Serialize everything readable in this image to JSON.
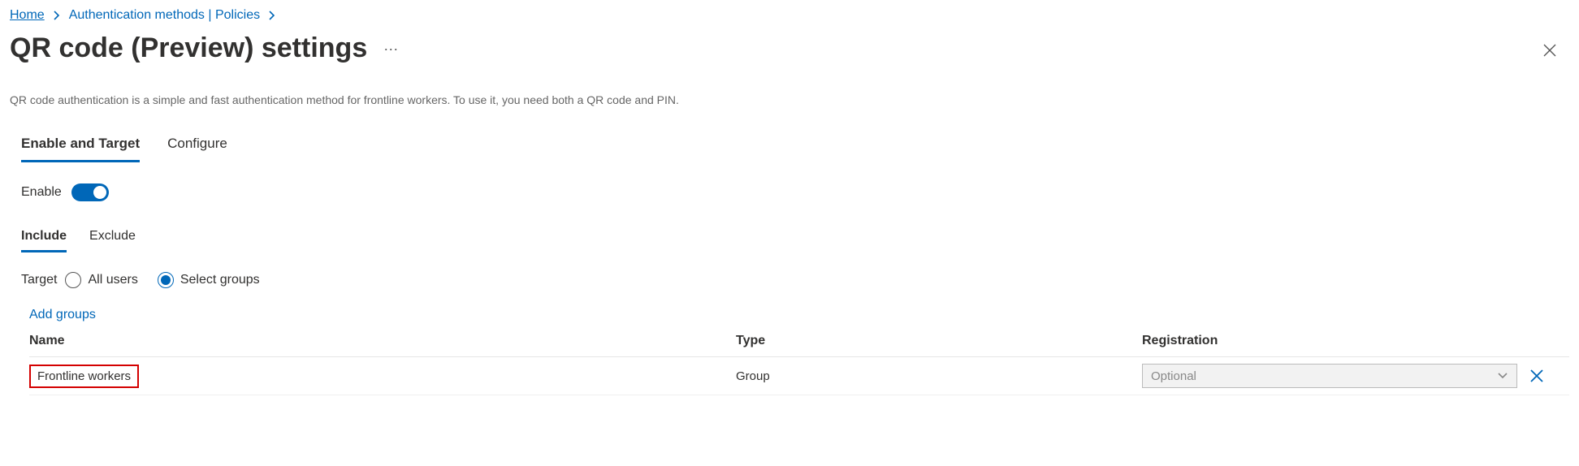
{
  "breadcrumb": {
    "home": "Home",
    "auth": "Authentication methods | Policies"
  },
  "title": "QR code (Preview) settings",
  "description": "QR code authentication is a simple and fast authentication method for frontline workers. To use it, you need both a QR code and PIN.",
  "tabs": {
    "enable_target": "Enable and Target",
    "configure": "Configure"
  },
  "enable": {
    "label": "Enable",
    "on": true
  },
  "subtabs": {
    "include": "Include",
    "exclude": "Exclude"
  },
  "target": {
    "label": "Target",
    "all_users": "All users",
    "select_groups": "Select groups"
  },
  "add_groups": "Add groups",
  "table": {
    "headers": {
      "name": "Name",
      "type": "Type",
      "registration": "Registration"
    },
    "rows": [
      {
        "name": "Frontline workers",
        "type": "Group",
        "registration_placeholder": "Optional"
      }
    ]
  },
  "colors": {
    "accent": "#0067b8",
    "highlight_border": "#d40000"
  }
}
